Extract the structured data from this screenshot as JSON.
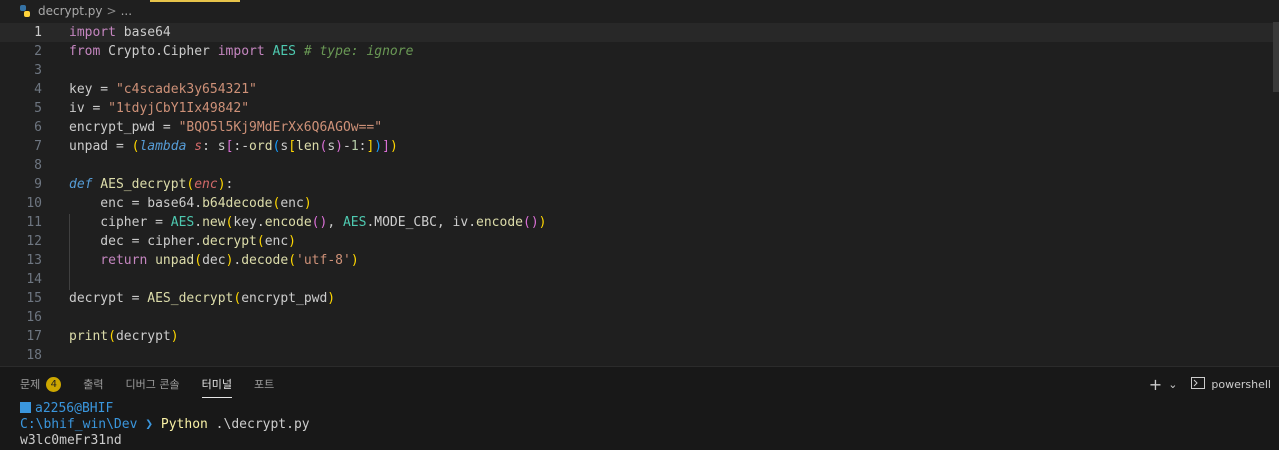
{
  "breadcrumb": {
    "file": "decrypt.py",
    "separator": ">",
    "more": "..."
  },
  "editor": {
    "current_line": 1,
    "line_numbers": [
      "1",
      "2",
      "3",
      "4",
      "5",
      "6",
      "7",
      "8",
      "9",
      "10",
      "11",
      "12",
      "13",
      "14",
      "15",
      "16",
      "17",
      "18"
    ],
    "lines": [
      [
        [
          "kw",
          "import"
        ],
        [
          "plain",
          " base64"
        ]
      ],
      [
        [
          "kw",
          "from"
        ],
        [
          "plain",
          " Crypto.Cipher "
        ],
        [
          "kw",
          "import"
        ],
        [
          "cls",
          " AES"
        ],
        [
          "cm",
          " # type: ignore"
        ]
      ],
      [],
      [
        [
          "plain",
          "key = "
        ],
        [
          "str",
          "\"c4scadek3y654321\""
        ]
      ],
      [
        [
          "plain",
          "iv = "
        ],
        [
          "str",
          "\"1tdyjCbY1Ix49842\""
        ]
      ],
      [
        [
          "plain",
          "encrypt_pwd = "
        ],
        [
          "str",
          "\"BQO5l5Kj9MdErXx6Q6AGOw==\""
        ]
      ],
      [
        [
          "plain",
          "unpad = "
        ],
        [
          "br1",
          "("
        ],
        [
          "def",
          "lambda"
        ],
        [
          "par",
          " s"
        ],
        [
          "plain",
          ": s"
        ],
        [
          "br2",
          "["
        ],
        [
          "plain",
          ":-"
        ],
        [
          "fn",
          "ord"
        ],
        [
          "br3",
          "("
        ],
        [
          "plain",
          "s"
        ],
        [
          "br1",
          "["
        ],
        [
          "fn",
          "len"
        ],
        [
          "br2",
          "("
        ],
        [
          "plain",
          "s"
        ],
        [
          "br2",
          ")"
        ],
        [
          "plain",
          "-"
        ],
        [
          "num",
          "1"
        ],
        [
          "plain",
          ":"
        ],
        [
          "br1",
          "]"
        ],
        [
          "br3",
          ")"
        ],
        [
          "br2",
          "]"
        ],
        [
          "br1",
          ")"
        ]
      ],
      [],
      [
        [
          "def",
          "def"
        ],
        [
          "fn",
          " AES_decrypt"
        ],
        [
          "br1",
          "("
        ],
        [
          "par",
          "enc"
        ],
        [
          "br1",
          ")"
        ],
        [
          "plain",
          ":"
        ]
      ],
      [
        [
          "plain",
          "    enc = base64."
        ],
        [
          "fn",
          "b64decode"
        ],
        [
          "br1",
          "("
        ],
        [
          "plain",
          "enc"
        ],
        [
          "br1",
          ")"
        ]
      ],
      [
        [
          "plain",
          "    cipher = "
        ],
        [
          "cls",
          "AES"
        ],
        [
          "plain",
          "."
        ],
        [
          "fn",
          "new"
        ],
        [
          "br1",
          "("
        ],
        [
          "plain",
          "key."
        ],
        [
          "fn",
          "encode"
        ],
        [
          "br2",
          "()"
        ],
        [
          "plain",
          ", "
        ],
        [
          "cls",
          "AES"
        ],
        [
          "plain",
          ".MODE_CBC, iv."
        ],
        [
          "fn",
          "encode"
        ],
        [
          "br2",
          "()"
        ],
        [
          "br1",
          ")"
        ]
      ],
      [
        [
          "plain",
          "    dec = cipher."
        ],
        [
          "fn",
          "decrypt"
        ],
        [
          "br1",
          "("
        ],
        [
          "plain",
          "enc"
        ],
        [
          "br1",
          ")"
        ]
      ],
      [
        [
          "kw",
          "    return"
        ],
        [
          "fn",
          " unpad"
        ],
        [
          "br1",
          "("
        ],
        [
          "plain",
          "dec"
        ],
        [
          "br1",
          ")"
        ],
        [
          "plain",
          "."
        ],
        [
          "fn",
          "decode"
        ],
        [
          "br1",
          "("
        ],
        [
          "str",
          "'utf-8'"
        ],
        [
          "br1",
          ")"
        ]
      ],
      [],
      [
        [
          "plain",
          "decrypt = "
        ],
        [
          "fn",
          "AES_decrypt"
        ],
        [
          "br1",
          "("
        ],
        [
          "plain",
          "encrypt_pwd"
        ],
        [
          "br1",
          ")"
        ]
      ],
      [],
      [
        [
          "fn",
          "print"
        ],
        [
          "br1",
          "("
        ],
        [
          "plain",
          "decrypt"
        ],
        [
          "br1",
          ")"
        ]
      ],
      []
    ]
  },
  "panel": {
    "tabs": [
      {
        "label": "문제",
        "badge": "4",
        "active": false
      },
      {
        "label": "출력",
        "active": false
      },
      {
        "label": "디버그 콘솔",
        "active": false
      },
      {
        "label": "터미널",
        "active": true
      },
      {
        "label": "포트",
        "active": false
      }
    ],
    "add_label": "+",
    "dropdown_label": "⌄",
    "shell_label": "powershell"
  },
  "terminal": {
    "user": "a2256@BHIF",
    "path": "C:\\bhif_win\\Dev",
    "arrow": "❯",
    "command": "Python",
    "args": " .\\decrypt.py",
    "output": "w3lc0meFr31nd"
  },
  "colors": {
    "accent": "#e6c34a",
    "badge": "#cca700",
    "terminal_blue": "#3a96dd"
  }
}
